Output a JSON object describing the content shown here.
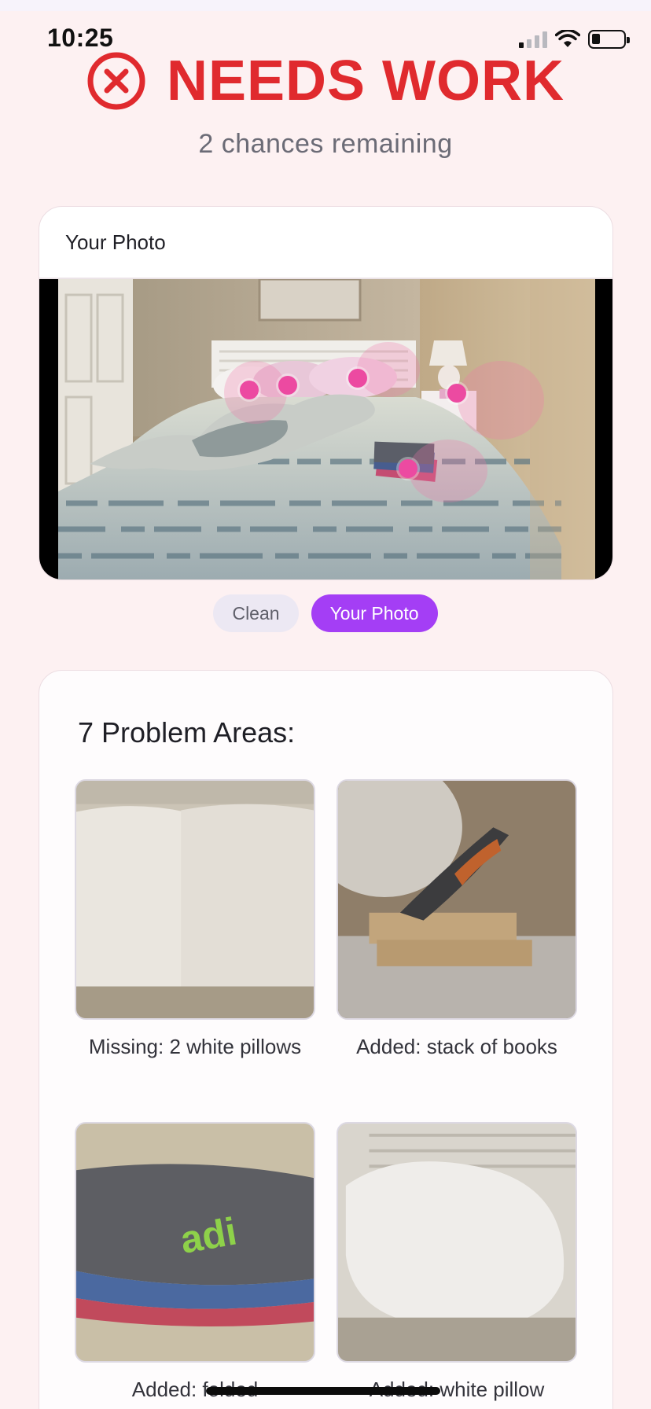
{
  "status_bar": {
    "time": "10:25"
  },
  "header": {
    "status": "NEEDS WORK",
    "chances": "2 chances remaining",
    "accent_color": "#e02a2e"
  },
  "photo_card": {
    "title": "Your Photo",
    "markers": 5
  },
  "view_toggle": {
    "options": [
      "Clean",
      "Your Photo"
    ],
    "selected": "Your Photo",
    "active_color": "#a43ef5"
  },
  "problems": {
    "title": "7 Problem Areas:",
    "items": [
      {
        "label": "Missing: 2 white pillows"
      },
      {
        "label": "Added: stack of books"
      },
      {
        "label": "Added: folded"
      },
      {
        "label": "Added: white pillow"
      }
    ]
  }
}
